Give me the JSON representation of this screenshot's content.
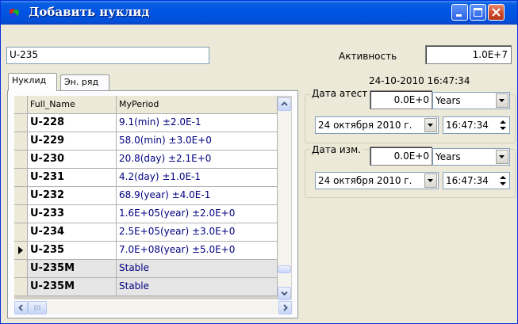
{
  "window": {
    "title": "Добавить нуклид"
  },
  "nuclide_input": {
    "value": "U-235"
  },
  "activity": {
    "label": "Активность",
    "value": "1.0E+7"
  },
  "timestamp": "24-10-2010 16:47:34",
  "tabs": [
    {
      "label": "Нуклид",
      "active": true
    },
    {
      "label": "Эн. ряд",
      "active": false
    }
  ],
  "table": {
    "columns": [
      "Full_Name",
      "MyPeriod"
    ],
    "current_row_index": 7,
    "rows": [
      {
        "name": "U-228",
        "period": "9.1(min) ±2.0E-1"
      },
      {
        "name": "U-229",
        "period": "58.0(min) ±3.0E+0"
      },
      {
        "name": "U-230",
        "period": "20.8(day) ±2.1E+0"
      },
      {
        "name": "U-231",
        "period": "4.2(day) ±1.0E-1"
      },
      {
        "name": "U-232",
        "period": "68.9(year) ±4.0E-1"
      },
      {
        "name": "U-233",
        "period": "1.6E+05(year) ±2.0E+0"
      },
      {
        "name": "U-234",
        "period": "2.5E+05(year) ±3.0E+0"
      },
      {
        "name": "U-235",
        "period": "7.0E+08(year) ±5.0E+0"
      },
      {
        "name": "U-235M",
        "period": "Stable"
      },
      {
        "name": "U-235M",
        "period": "Stable"
      }
    ]
  },
  "attest_group": {
    "title": "Дата атест",
    "value": "0.0E+0",
    "unit": "Years",
    "date": "24  октября  2010 г.",
    "time": "16:47:34"
  },
  "measure_group": {
    "title": "Дата изм.",
    "value": "0.0E+0",
    "unit": "Years",
    "date": "24  октября  2010 г.",
    "time": "16:47:34"
  }
}
